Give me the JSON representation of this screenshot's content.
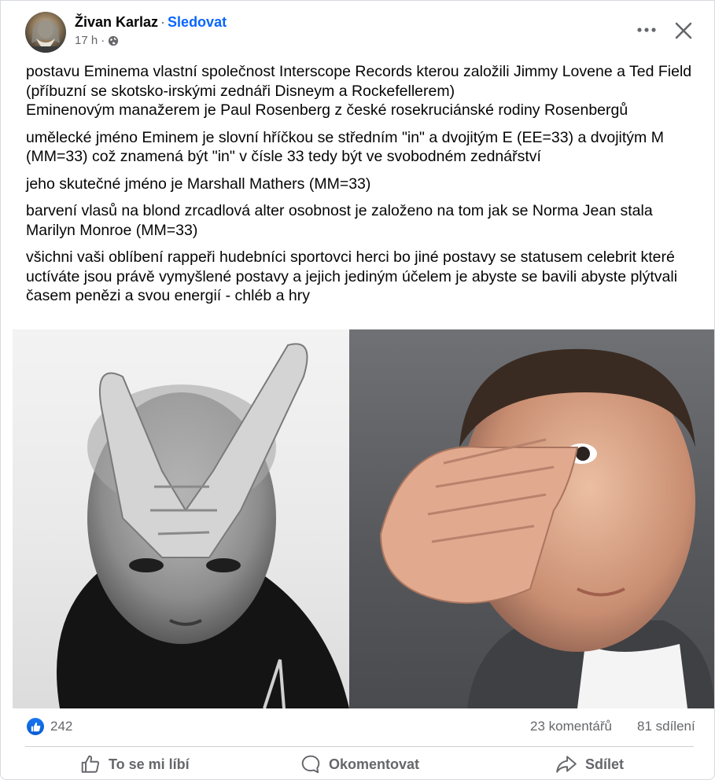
{
  "post": {
    "author": "Živan Karlaz",
    "separator": "·",
    "follow_label": "Sledovat",
    "timestamp": "17 h",
    "audience_icon": "globe-icon",
    "menu_icon": "more-icon",
    "close_icon": "close-icon",
    "paragraphs": [
      "postavu Eminema vlastní společnost Interscope Records kterou založili Jimmy Lovene a Ted Field (příbuzní se skotsko-irskými zednáři Disneym a Rockefellerem)",
      "Eminenovým manažerem je Paul Rosenberg z české rosekruciánské rodiny Rosenbergů",
      "umělecké jméno Eminem je slovní hříčkou se středním \"in\" a dvojitým E (EE=33) a dvojitým M (MM=33) což znamená být \"in\" v čísle 33 tedy být ve svobodném zednářství",
      "jeho skutečné jméno je Marshall Mathers (MM=33)",
      "barvení vlasů na blond zrcadlová alter osobnost je založeno na tom jak se Norma Jean stala Marilyn Monroe (MM=33)",
      "všichni vaši oblíbení rappeři hudebníci sportovci herci bo jiné postavy se statusem celebrit které uctíváte jsou právě vymyšlené postavy a jejich jediným účelem je abyste se bavili abyste plýtvali časem penězi a svou energií - chléb a hry"
    ]
  },
  "stats": {
    "reaction_icon": "like-icon",
    "reactions": "242",
    "comments": "23 komentářů",
    "shares": "81 sdílení"
  },
  "actions": {
    "like": "To se mi líbí",
    "comment": "Okomentovat",
    "share": "Sdílet"
  },
  "colors": {
    "accent": "#0866ff",
    "secondary_text": "#65676b",
    "text": "#050505"
  }
}
